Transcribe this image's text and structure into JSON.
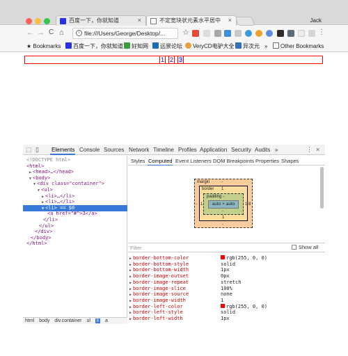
{
  "browser": {
    "tabs": [
      {
        "label": "百度一下，你就知道",
        "close": "×",
        "active": false
      },
      {
        "label": "不定宽块状元素水平居中",
        "close": "×",
        "active": true
      }
    ],
    "user": "Jack",
    "url": "file:///Users/George/Desktop/...",
    "nav": {
      "back": "←",
      "forward": "→",
      "reload": "C",
      "home": "⌂",
      "star": "☆",
      "menu": "⋮"
    }
  },
  "bookmarks": {
    "items": [
      {
        "label": "Bookmarks",
        "icon": "star-icon"
      },
      {
        "label": "百度一下，你就知道",
        "icon": "baidu-icon"
      },
      {
        "label": "好知网",
        "icon": "haozhi-icon"
      },
      {
        "label": "远景论坛",
        "icon": "pcbeta-icon"
      },
      {
        "label": "VeryCD电驴大全",
        "icon": "verycd-icon"
      },
      {
        "label": "异次元",
        "icon": "iplaysoft-icon"
      }
    ],
    "more": "»",
    "other": "Other Bookmarks"
  },
  "page": {
    "pagination": [
      "1",
      "2",
      "3"
    ]
  },
  "devtools": {
    "tabs": [
      "Elements",
      "Console",
      "Sources",
      "Network",
      "Timeline",
      "Profiles",
      "Application",
      "Security",
      "Audits",
      "»"
    ],
    "selected_tab": "Elements",
    "dom_lines": [
      {
        "indent": 0,
        "arrow": "",
        "text": "<!DOCTYPE html>",
        "kind": "cm"
      },
      {
        "indent": 0,
        "arrow": "",
        "text": "<html>",
        "kind": "tag"
      },
      {
        "indent": 1,
        "arrow": "▶",
        "text": "<head>…</head>",
        "kind": "tag"
      },
      {
        "indent": 1,
        "arrow": "▼",
        "text": "<body>",
        "kind": "tag"
      },
      {
        "indent": 2,
        "arrow": "▼",
        "text": "<div class=\"container\">",
        "kind": "tag"
      },
      {
        "indent": 3,
        "arrow": "▼",
        "text": "<ul>",
        "kind": "tag"
      },
      {
        "indent": 4,
        "arrow": "▶",
        "text": "<li>…</li>",
        "kind": "tag"
      },
      {
        "indent": 4,
        "arrow": "▶",
        "text": "<li>…</li>",
        "kind": "tag"
      },
      {
        "indent": 4,
        "arrow": "▼",
        "text": "<li> == $0",
        "kind": "sel"
      },
      {
        "indent": 5,
        "arrow": "",
        "text": "<a href=\"#\">3</a>",
        "kind": "tag"
      },
      {
        "indent": 4,
        "arrow": "",
        "text": "</li>",
        "kind": "tag"
      },
      {
        "indent": 3,
        "arrow": "",
        "text": "</ul>",
        "kind": "tag"
      },
      {
        "indent": 2,
        "arrow": "",
        "text": "</div>",
        "kind": "tag"
      },
      {
        "indent": 1,
        "arrow": "",
        "text": "</body>",
        "kind": "tag"
      },
      {
        "indent": 0,
        "arrow": "",
        "text": "</html>",
        "kind": "tag"
      }
    ],
    "breadcrumbs": [
      "html",
      "body",
      "div.container",
      "ul",
      "li",
      "a"
    ],
    "breadcrumb_selected": "li",
    "styles_tabs": [
      "Styles",
      "Computed",
      "Event Listeners",
      "DOM Breakpoints",
      "Properties",
      "Shapes"
    ],
    "styles_selected": "Computed",
    "box_model": {
      "margin_label": "margin",
      "margin_value": "-",
      "border_label": "border",
      "border_value": "1",
      "padding_label": "padding -",
      "padding_bottom": "-",
      "content": "auto × auto",
      "left": "1",
      "right": "1",
      "margin_left": "-",
      "margin_right": "8",
      "border_bottom": "1",
      "margin_bottom": "-"
    },
    "filter_placeholder": "Filter",
    "show_all": "Show all",
    "computed": [
      {
        "name": "border-bottom-color",
        "value": "rgb(255, 0, 0)",
        "swatch": "#ff0000"
      },
      {
        "name": "border-bottom-style",
        "value": "solid"
      },
      {
        "name": "border-bottom-width",
        "value": "1px"
      },
      {
        "name": "border-image-outset",
        "value": "0px"
      },
      {
        "name": "border-image-repeat",
        "value": "stretch"
      },
      {
        "name": "border-image-slice",
        "value": "100%"
      },
      {
        "name": "border-image-source",
        "value": "none"
      },
      {
        "name": "border-image-width",
        "value": "1"
      },
      {
        "name": "border-left-color",
        "value": "rgb(255, 0, 0)",
        "swatch": "#ff0000"
      },
      {
        "name": "border-left-style",
        "value": "solid"
      },
      {
        "name": "border-left-width",
        "value": "1px"
      }
    ]
  },
  "colors": {
    "accent": "#3879d9",
    "red_border": "#ff0000",
    "close_light": "#fc605c",
    "min_light": "#fdbc40",
    "max_light": "#34c84a"
  }
}
